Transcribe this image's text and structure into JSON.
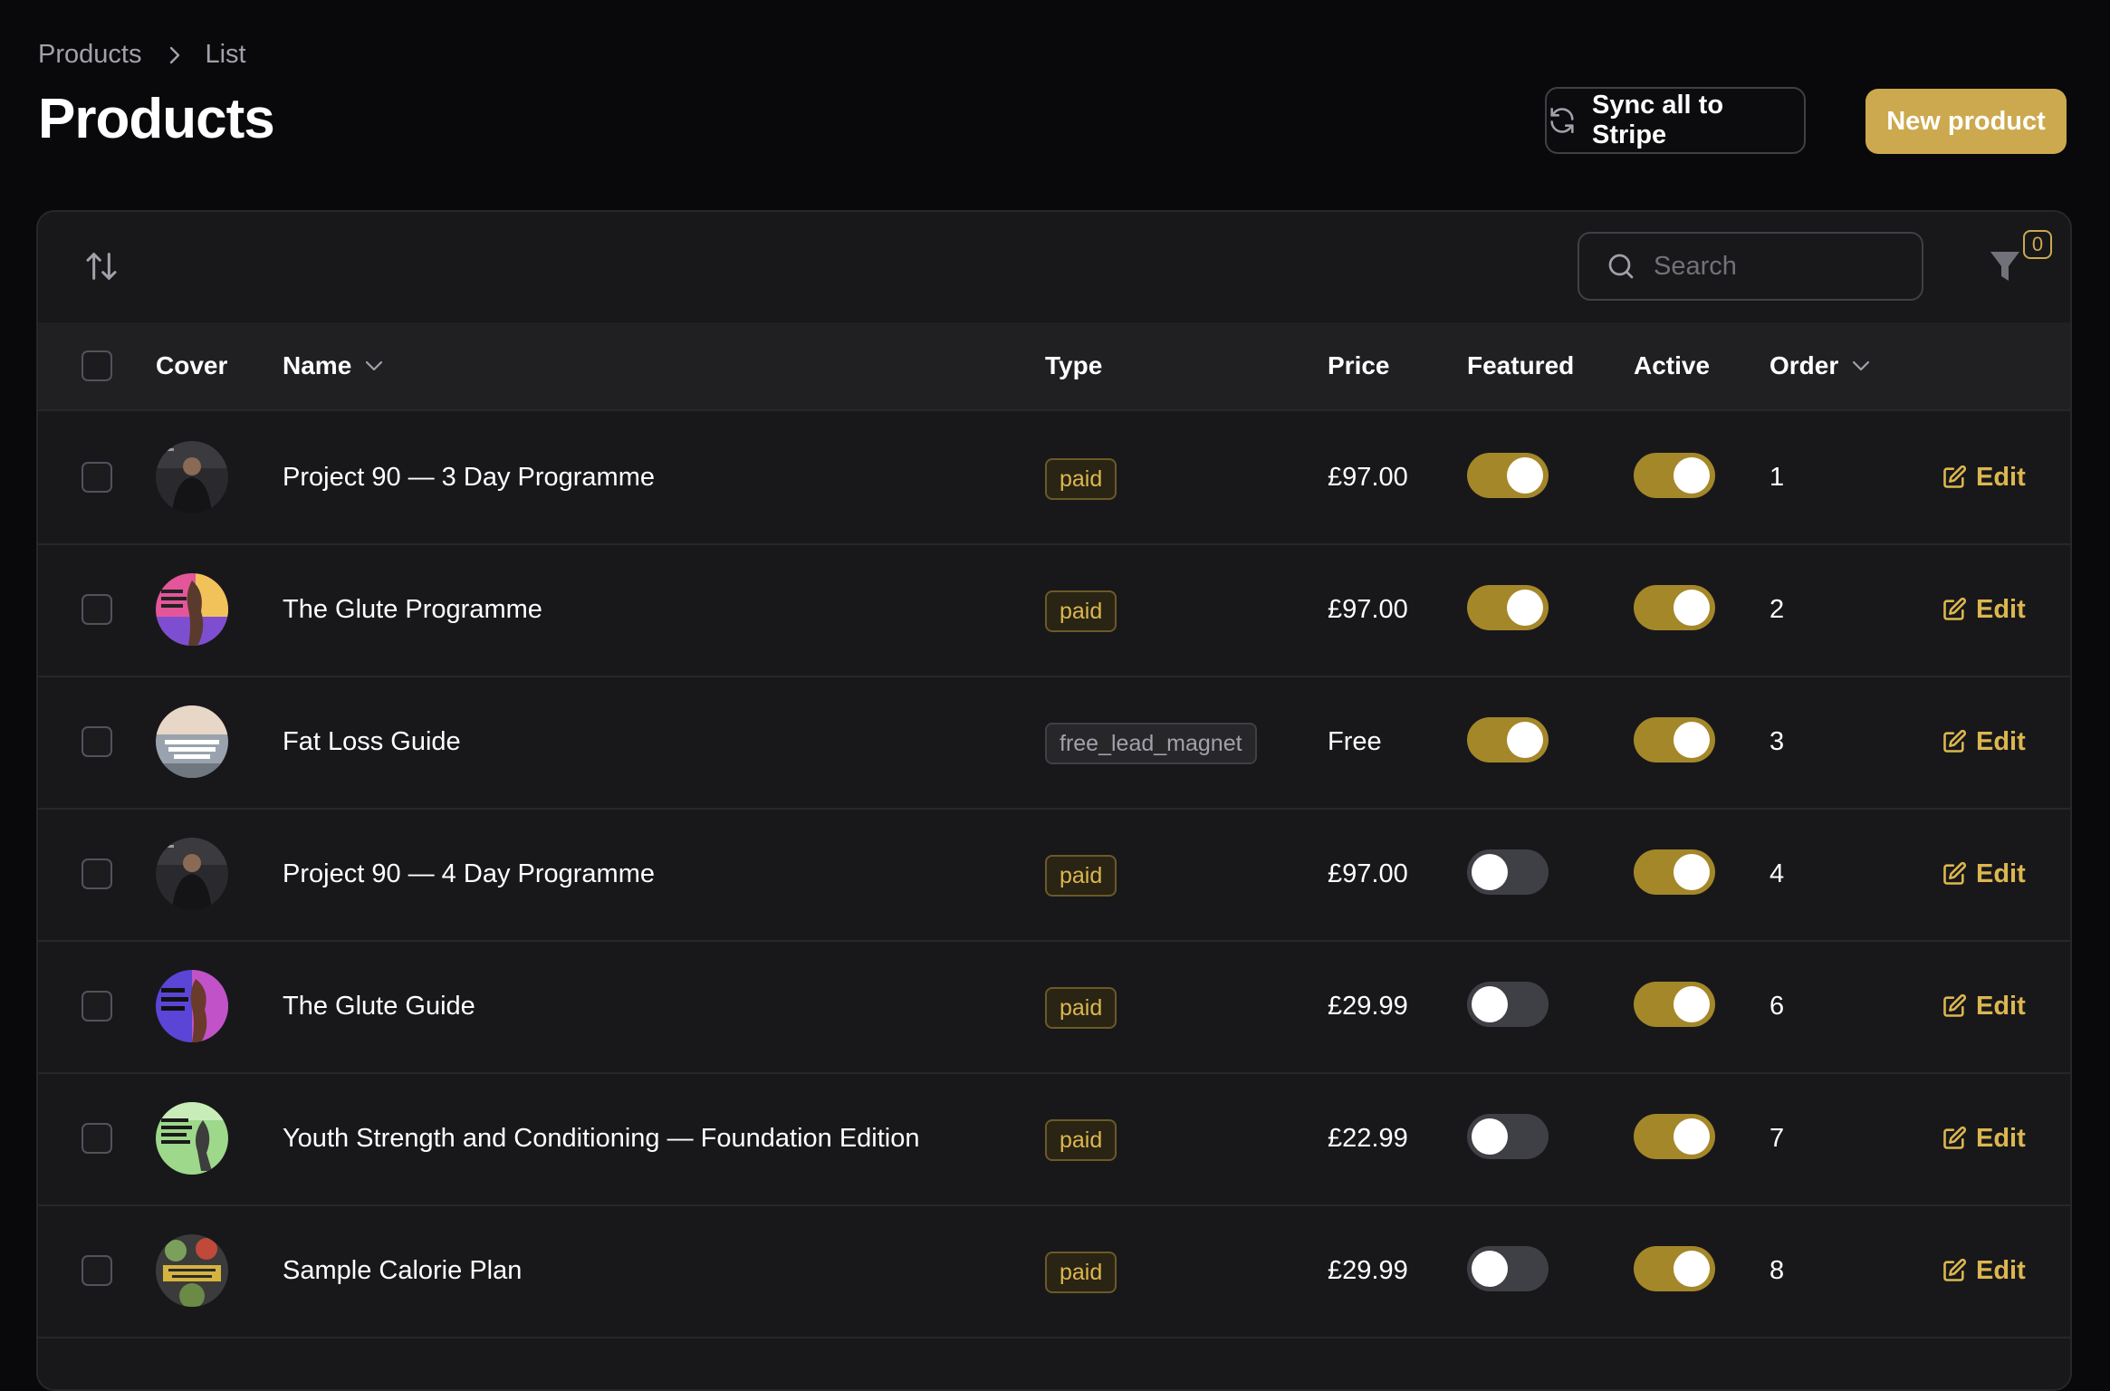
{
  "breadcrumb": {
    "items": [
      "Products",
      "List"
    ]
  },
  "page": {
    "title": "Products"
  },
  "actions": {
    "sync_label": "Sync all to Stripe",
    "new_label": "New product"
  },
  "toolbar": {
    "search_placeholder": "Search",
    "filter_count": "0"
  },
  "table": {
    "headers": {
      "cover": "Cover",
      "name": "Name",
      "type": "Type",
      "price": "Price",
      "featured": "Featured",
      "active": "Active",
      "order": "Order"
    },
    "edit_label": "Edit",
    "rows": [
      {
        "name": "Project 90 — 3 Day Programme",
        "type": "paid",
        "price": "£97.00",
        "featured": true,
        "active": true,
        "order": "1"
      },
      {
        "name": "The Glute Programme",
        "type": "paid",
        "price": "£97.00",
        "featured": true,
        "active": true,
        "order": "2"
      },
      {
        "name": "Fat Loss Guide",
        "type": "free_lead_magnet",
        "price": "Free",
        "featured": true,
        "active": true,
        "order": "3"
      },
      {
        "name": "Project 90 — 4 Day Programme",
        "type": "paid",
        "price": "£97.00",
        "featured": false,
        "active": true,
        "order": "4"
      },
      {
        "name": "The Glute Guide",
        "type": "paid",
        "price": "£29.99",
        "featured": false,
        "active": true,
        "order": "6"
      },
      {
        "name": "Youth Strength and Conditioning — Foundation Edition",
        "type": "paid",
        "price": "£22.99",
        "featured": false,
        "active": true,
        "order": "7"
      },
      {
        "name": "Sample Calorie Plan",
        "type": "paid",
        "price": "£29.99",
        "featured": false,
        "active": true,
        "order": "8"
      }
    ]
  },
  "colors": {
    "accent": "#cca94e",
    "toggle_on": "#a48729",
    "background": "#09090b",
    "surface": "#18181b"
  },
  "icons": {
    "sort": "sort-arrows-icon",
    "search": "search-icon",
    "filter": "filter-icon",
    "sync": "refresh-icon",
    "edit": "edit-icon",
    "chevron": "chevron-down-icon",
    "breadcrumb_sep": "chevron-right-icon"
  }
}
